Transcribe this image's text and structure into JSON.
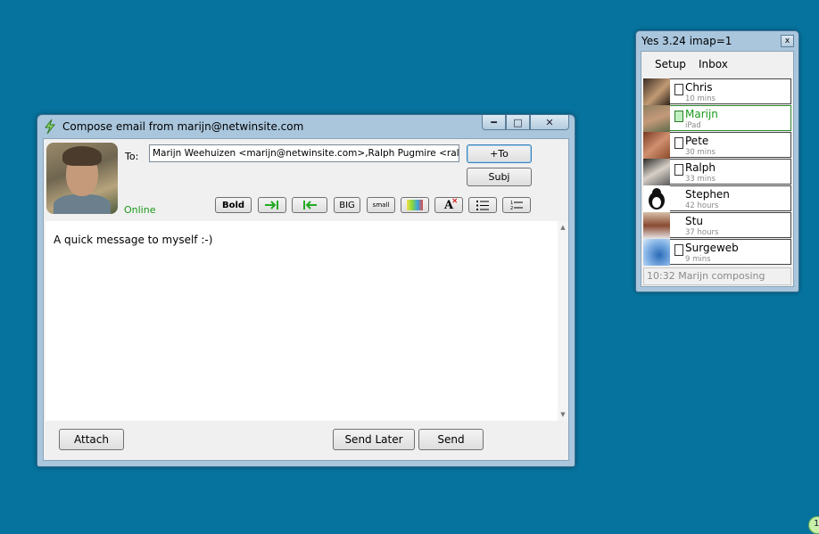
{
  "compose": {
    "title": "Compose email from marijn@netwinsite.com",
    "to_label": "To:",
    "to_value": "Marijn Weehuizen <marijn@netwinsite.com>,Ralph Pugmire <ralph@netw",
    "status": "Online",
    "add_to_label": "+To",
    "subj_label": "Subj",
    "toolbar": {
      "bold": "Bold",
      "big": "BIG",
      "small": "small"
    },
    "body": "A quick message to myself :-)",
    "attach_label": "Attach",
    "send_later_label": "Send Later",
    "send_label": "Send"
  },
  "buddy": {
    "title": "Yes 3.24 imap=1",
    "close_label": "x",
    "menu": [
      "Setup",
      "Inbox"
    ],
    "contacts": [
      {
        "name": "Chris",
        "sub": "10 mins",
        "has_box": true,
        "online": false
      },
      {
        "name": "Marijn",
        "sub": "iPad",
        "has_box": true,
        "online": true
      },
      {
        "name": "Pete",
        "sub": "30 mins",
        "has_box": true,
        "online": false
      },
      {
        "name": "Ralph",
        "sub": "33 mins",
        "has_box": true,
        "online": false
      },
      {
        "name": "Stephen",
        "sub": "42 hours",
        "has_box": false,
        "online": false
      },
      {
        "name": "Stu",
        "sub": "37 hours",
        "has_box": false,
        "online": false
      },
      {
        "name": "Surgeweb",
        "sub": "9 mins",
        "has_box": true,
        "online": false
      }
    ],
    "status": "10:32 Marijn composing"
  },
  "badge": "1",
  "colors": {
    "desktop": "#06739e",
    "online_green": "#1a9a1a"
  }
}
